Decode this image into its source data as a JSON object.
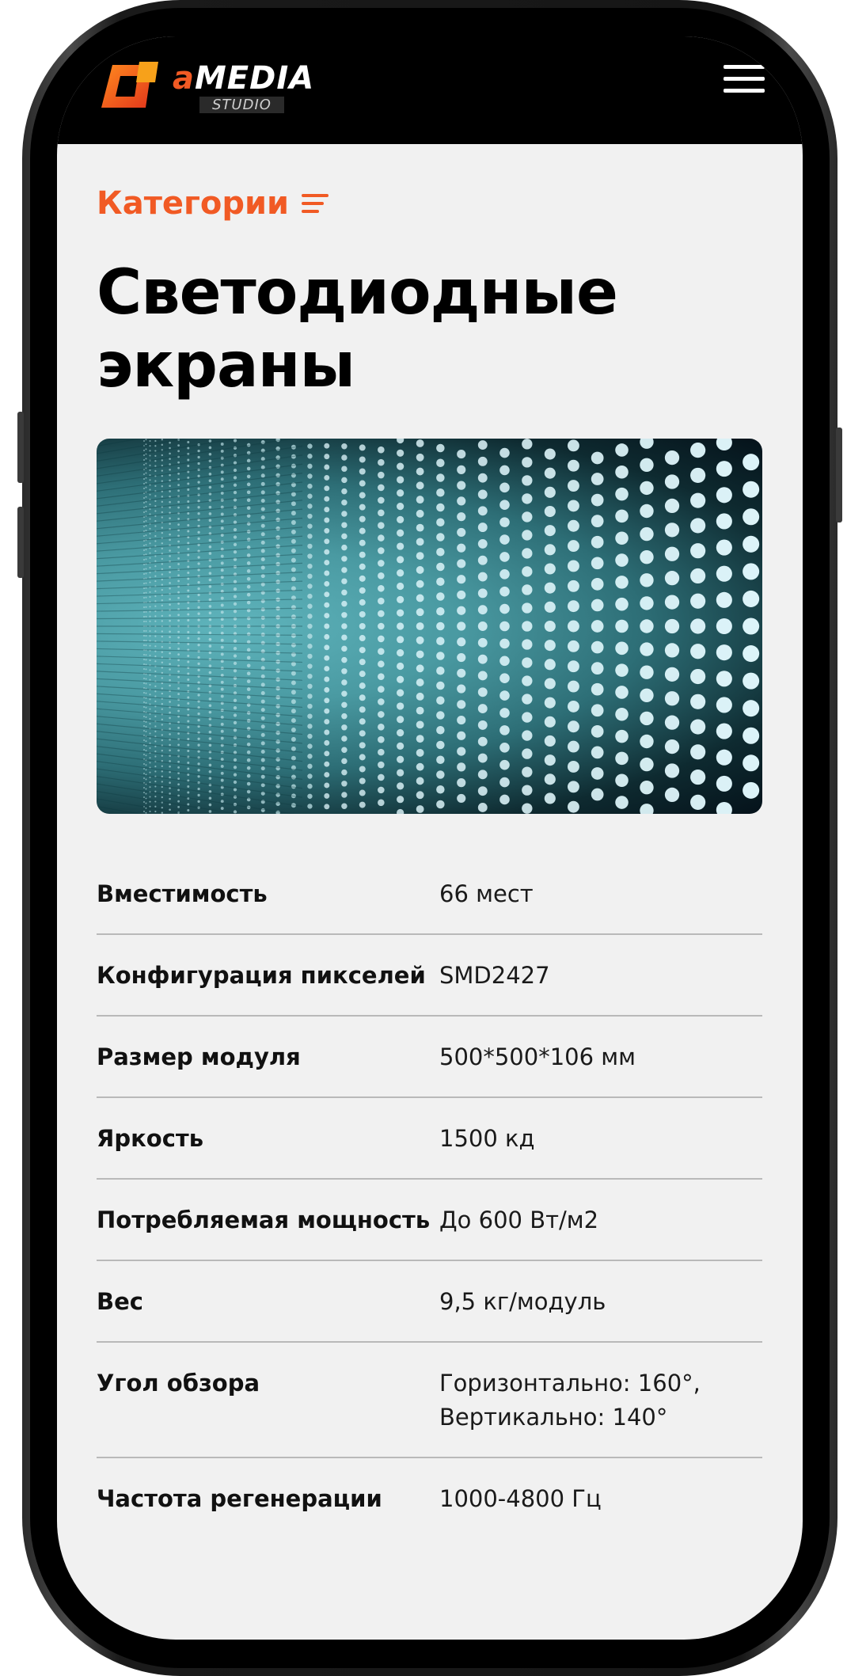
{
  "header": {
    "logo_main": "MEDIA",
    "logo_mark": "a",
    "logo_sub": "STUDIO",
    "menu_icon": "hamburger-icon"
  },
  "categories": {
    "label": "Категории",
    "icon": "list-icon"
  },
  "page": {
    "title_line1": "Светодиодные",
    "title_line2": "экраны"
  },
  "hero": {
    "image": "led-screen-closeup"
  },
  "specs": [
    {
      "label": "Вместимость",
      "value": "66 мест"
    },
    {
      "label": "Конфигурация пикселей",
      "value": "SMD2427"
    },
    {
      "label": "Размер модуля",
      "value": "500*500*106 мм"
    },
    {
      "label": "Яркость",
      "value": "1500 кд"
    },
    {
      "label": "Потребляемая мощность",
      "value": "До 600 Вт/м2"
    },
    {
      "label": "Вес",
      "value": "9,5 кг/модуль"
    },
    {
      "label": "Угол обзора",
      "value": "Горизонтально: 160°, Вертикально: 140°"
    },
    {
      "label": "Частота регенерации",
      "value": "1000-4800 Гц"
    }
  ],
  "colors": {
    "accent": "#f15a24",
    "appbar": "#000000",
    "background": "#f1f1f1",
    "divider": "#b9b9b9"
  }
}
